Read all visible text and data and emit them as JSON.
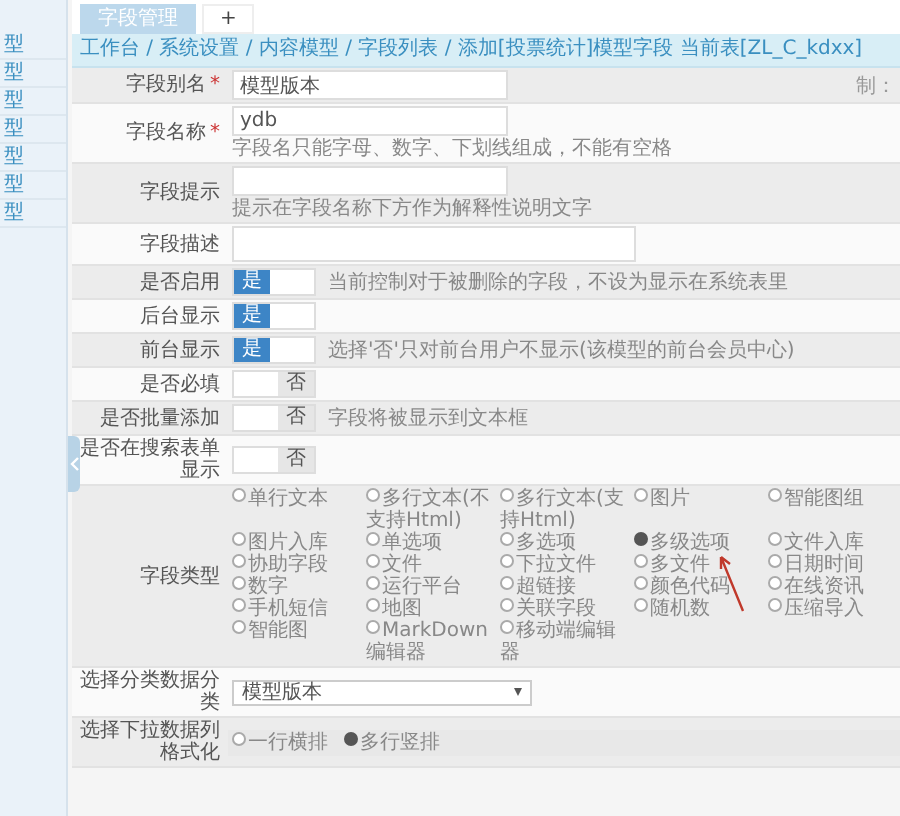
{
  "sidebar": {
    "items": [
      "型",
      "型",
      "型",
      "型",
      "型",
      "型",
      "型"
    ]
  },
  "tabs": [
    {
      "label": "字段管理",
      "selected": true
    },
    {
      "label": "+",
      "selected": false
    }
  ],
  "breadcrumb": "工作台 / 系统设置 / 内容模型 / 字段列表 / 添加[投票统计]模型字段 当前表[ZL_C_kdxx]",
  "side_note": "制：",
  "form": {
    "rows": [
      {
        "kind": "input",
        "label": "字段别名",
        "required_mark": "*",
        "value": "模型版本"
      },
      {
        "kind": "input",
        "label": "字段名称",
        "required_mark": "*",
        "value": "ydb",
        "hint": "字段名只能字母、数字、下划线组成，不能有空格"
      },
      {
        "kind": "input",
        "label": "字段提示",
        "value": "",
        "hint": "提示在字段名称下方作为解释性说明文字"
      },
      {
        "kind": "textarea",
        "label": "字段描述"
      },
      {
        "kind": "switch",
        "label": "是否启用",
        "on": true,
        "switch_label": "是",
        "hint": "当前控制对于被删除的字段，不设为显示在系统表里"
      },
      {
        "kind": "switch",
        "label": "后台显示",
        "on": true,
        "switch_label": "是"
      },
      {
        "kind": "switch",
        "label": "前台显示",
        "on": true,
        "switch_label": "是",
        "hint": "选择'否'只对前台用户不显示(该模型的前台会员中心)"
      },
      {
        "kind": "switch",
        "label": "是否必填",
        "on": false,
        "switch_label": "否"
      },
      {
        "kind": "switch",
        "label": "是否批量添加",
        "on": false,
        "switch_label": "否",
        "hint": "字段将被显示到文本框"
      },
      {
        "kind": "switch",
        "label": "是否在搜索表单显示",
        "on": false,
        "switch_label": "否"
      },
      {
        "kind": "radio-grid",
        "label": "字段类型",
        "options": [
          {
            "label": "单行文本",
            "selected": false
          },
          {
            "label": "多行文本(不支持Html)",
            "selected": false
          },
          {
            "label": "多行文本(支持Html)",
            "selected": false
          },
          {
            "label": "图片",
            "selected": false
          },
          {
            "label": "智能图组",
            "selected": false
          },
          {
            "label": "图片入库",
            "selected": false
          },
          {
            "label": "单选项",
            "selected": false
          },
          {
            "label": "多选项",
            "selected": false
          },
          {
            "label": "多级选项",
            "selected": true,
            "annotated": true
          },
          {
            "label": "文件入库",
            "selected": false
          },
          {
            "label": "协助字段",
            "selected": false
          },
          {
            "label": "文件",
            "selected": false
          },
          {
            "label": "下拉文件",
            "selected": false
          },
          {
            "label": "多文件",
            "selected": false
          },
          {
            "label": "日期时间",
            "selected": false
          },
          {
            "label": "数字",
            "selected": false
          },
          {
            "label": "运行平台",
            "selected": false
          },
          {
            "label": "超链接",
            "selected": false
          },
          {
            "label": "颜色代码",
            "selected": false
          },
          {
            "label": "在线资讯",
            "selected": false
          },
          {
            "label": "手机短信",
            "selected": false
          },
          {
            "label": "地图",
            "selected": false
          },
          {
            "label": "关联字段",
            "selected": false
          },
          {
            "label": "随机数",
            "selected": false
          },
          {
            "label": "压缩导入",
            "selected": false
          },
          {
            "label": "智能图",
            "selected": false
          },
          {
            "label": "MarkDown编辑器",
            "selected": false
          },
          {
            "label": "移动端编辑器",
            "selected": false
          }
        ]
      },
      {
        "kind": "select",
        "label": "选择分类数据分类",
        "value": "模型版本"
      },
      {
        "kind": "radio-inline",
        "label": "选择下拉数据列格式化",
        "options": [
          {
            "label": "一行横排",
            "selected": false
          },
          {
            "label": "多行竖排",
            "selected": true
          }
        ]
      }
    ]
  }
}
